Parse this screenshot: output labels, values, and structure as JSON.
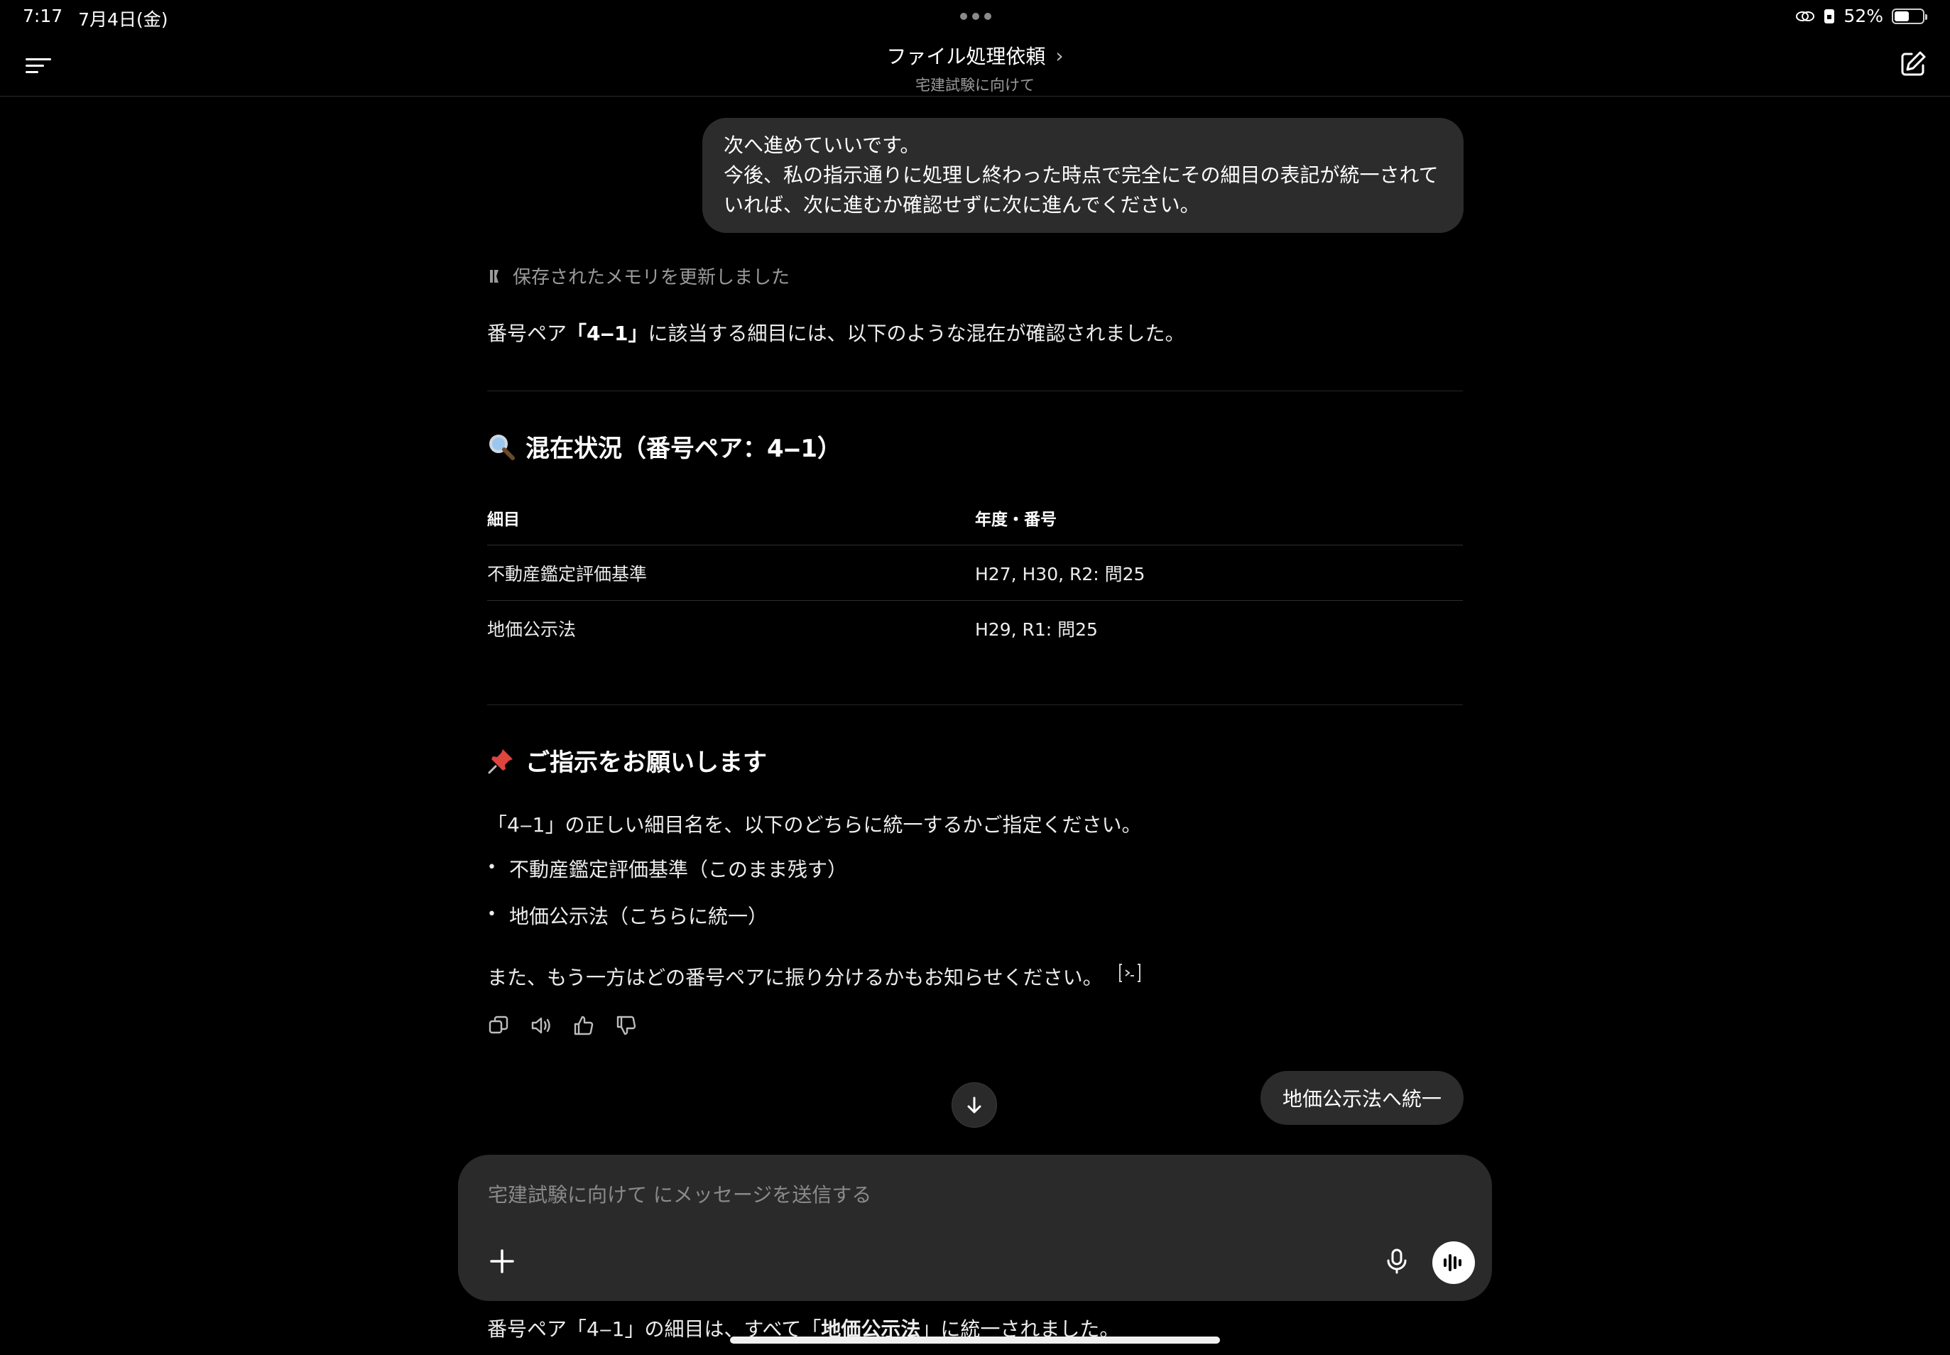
{
  "status": {
    "time": "7:17",
    "date": "7月4日(金)",
    "battery": "52%",
    "battery_level": 0.52
  },
  "header": {
    "title": "ファイル処理依頼",
    "subtitle": "宅建試験に向けて"
  },
  "messages": {
    "user_line1": "次へ進めていいです。",
    "user_line2": "今後、私の指示通りに処理し終わった時点で完全にその細目の表記が統一されて",
    "user_line3": "いれば、次に進むか確認せずに次に進んでください。",
    "memory_note": "保存されたメモリを更新しました",
    "intro_pre": "番号ペア",
    "intro_bold": "「4‒1」",
    "intro_post": "に該当する細目には、以下のような混在が確認されました。",
    "section1_title": "混在状況（番号ペア：4‒1）",
    "table_headers": [
      "細目",
      "年度・番号"
    ],
    "table_rows": [
      [
        "不動産鑑定評価基準",
        "H27, H30, R2: 問25"
      ],
      [
        "地価公示法",
        "H29, R1: 問25"
      ]
    ],
    "section2_title": "ご指示をお願いします",
    "instruction": "「4‒1」の正しい細目名を、以下のどちらに統一するかご指定ください。",
    "bullets": [
      "不動産鑑定評価基準（このまま残す）",
      "地価公示法（こちらに統一）"
    ],
    "followup": "また、もう一方はどの番号ペアに振り分けるかもお知らせください。",
    "user_reply": "地価公示法へ統一",
    "next_pre": "番号ペア「4‒1」の細目は、",
    "next_u1": "すべて「",
    "next_bold": "地価公示法",
    "next_u2": "」に統一",
    "next_post": "されました。"
  },
  "composer": {
    "placeholder": "宅建試験に向けて にメッセージを送信する"
  },
  "icons": {
    "menu": "menu-icon",
    "edit": "new-chat-icon",
    "memory": "memory-icon",
    "search": "magnifier-icon",
    "pin": "pushpin-icon",
    "copy": "copy-icon",
    "speaker": "read-aloud-icon",
    "like": "thumbs-up-icon",
    "dislike": "thumbs-down-icon",
    "scroll": "arrow-down-icon",
    "plus": "plus-icon",
    "mic": "microphone-icon",
    "voice": "voice-mode-icon"
  }
}
